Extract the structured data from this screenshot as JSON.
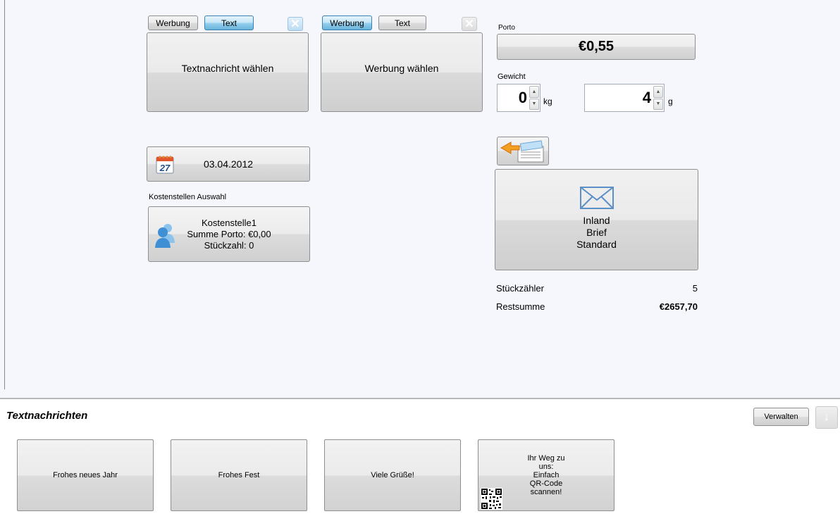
{
  "left_message": {
    "werbung_label": "Werbung",
    "text_label": "Text",
    "main_label": "Textnachricht wählen"
  },
  "right_message": {
    "werbung_label": "Werbung",
    "text_label": "Text",
    "main_label": "Werbung wählen"
  },
  "date": {
    "value": "03.04.2012",
    "calendar_day": "27"
  },
  "cost_center": {
    "heading": "Kostenstellen Auswahl",
    "name": "Kostenstelle1",
    "porto_sum": "Summe Porto: €0,00",
    "count": "Stückzahl: 0"
  },
  "porto": {
    "label": "Porto",
    "value": "€0,55"
  },
  "weight": {
    "label": "Gewicht",
    "kg_value": "0",
    "kg_unit": "kg",
    "g_value": "4",
    "g_unit": "g"
  },
  "product": {
    "line1": "Inland",
    "line2": "Brief",
    "line3": "Standard"
  },
  "counters": {
    "count_label": "Stückzähler",
    "count_value": "5",
    "rest_label": "Restsumme",
    "rest_value": "€2657,70"
  },
  "bottom": {
    "title": "Textnachrichten",
    "manage_label": "Verwalten",
    "messages": [
      {
        "label": "Frohes neues Jahr"
      },
      {
        "label": "Frohes Fest"
      },
      {
        "label": "Viele Grüße!"
      },
      {
        "l1": "Ihr Weg zu",
        "l2": "uns:",
        "l3": "Einfach",
        "l4": "QR-Code",
        "l5": "scannen!"
      }
    ]
  },
  "colors": {
    "background": "#f6f7fc",
    "pressed_blue": "#98d1ef",
    "icon_blue": "#5a8fc8"
  }
}
